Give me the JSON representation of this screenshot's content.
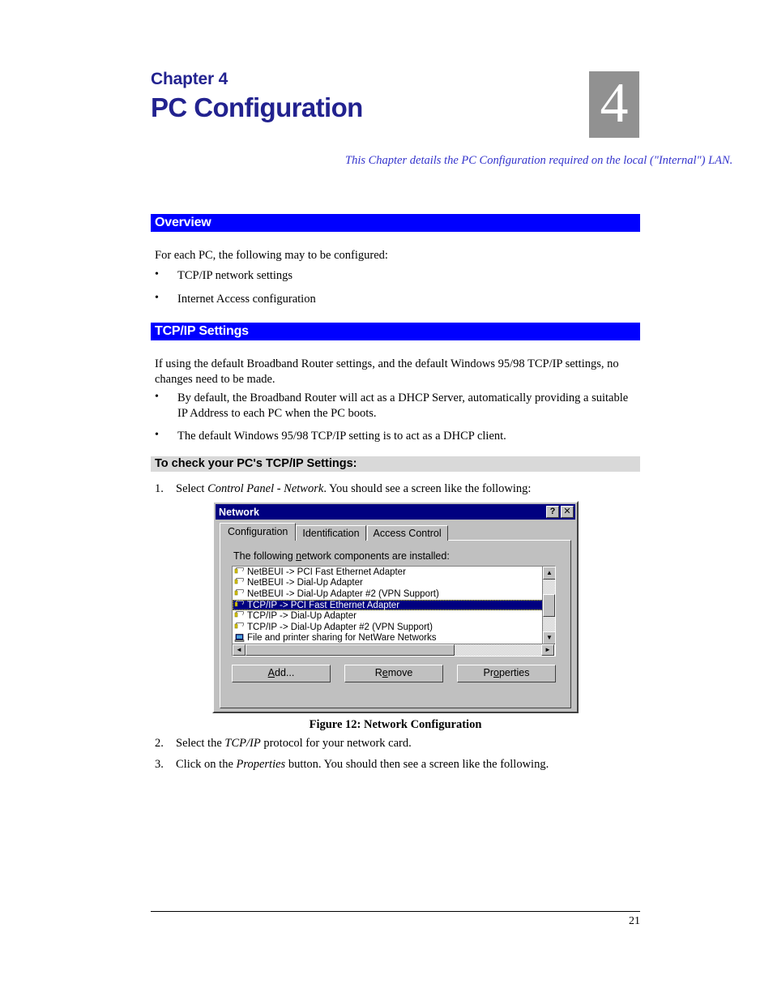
{
  "chapter": {
    "label": "Chapter 4",
    "title": "PC Configuration",
    "number": "4",
    "intro": "This Chapter details the PC Configuration required on the local (\"Internal\") LAN."
  },
  "sections": {
    "overview": {
      "heading": "Overview",
      "intro": "For each PC, the following may to be configured:",
      "bullets": [
        "TCP/IP network settings",
        "Internet Access configuration"
      ]
    },
    "tcpip": {
      "heading": "TCP/IP Settings",
      "intro": "If using the default Broadband Router settings, and the default Windows 95/98 TCP/IP settings, no changes need to be made.",
      "bullets": [
        "By default, the Broadband Router will act as a DHCP Server, automatically providing a suitable IP Address to each PC when the PC boots.",
        "The default Windows 95/98 TCP/IP setting is to act as a DHCP client."
      ]
    },
    "check_settings": {
      "heading": "To check your PC's TCP/IP Settings:",
      "step1_num": "1.",
      "step1_pre": "Select ",
      "step1_italic": "Control Panel - Network",
      "step1_post": ". You should see a screen like the following:",
      "step2_num": "2.",
      "step2_pre": "Select the ",
      "step2_italic": "TCP/IP",
      "step2_post": " protocol for your network card.",
      "step3_num": "3.",
      "step3_pre": "Click on the ",
      "step3_italic": "Properties",
      "step3_post": " button. You should then see a screen like the following."
    }
  },
  "figure": {
    "caption": "Figure 12: Network Configuration"
  },
  "dialog": {
    "title": "Network",
    "titlebar_help": "?",
    "titlebar_close": "✕",
    "tabs": [
      {
        "label": "Configuration",
        "active": true
      },
      {
        "label": "Identification",
        "active": false
      },
      {
        "label": "Access Control",
        "active": false
      }
    ],
    "list_label_pre": "The following ",
    "list_label_accel": "n",
    "list_label_post": "etwork components are installed:",
    "components": [
      {
        "label": "NetBEUI -> PCI Fast Ethernet Adapter",
        "icon": "protocol-icon",
        "selected": false
      },
      {
        "label": "NetBEUI -> Dial-Up Adapter",
        "icon": "protocol-icon",
        "selected": false
      },
      {
        "label": "NetBEUI -> Dial-Up Adapter #2 (VPN Support)",
        "icon": "protocol-icon",
        "selected": false
      },
      {
        "label": "TCP/IP -> PCI Fast Ethernet Adapter",
        "icon": "protocol-icon",
        "selected": true
      },
      {
        "label": "TCP/IP -> Dial-Up Adapter",
        "icon": "protocol-icon",
        "selected": false
      },
      {
        "label": "TCP/IP -> Dial-Up Adapter #2 (VPN Support)",
        "icon": "protocol-icon",
        "selected": false
      },
      {
        "label": "File and printer sharing for NetWare Networks",
        "icon": "computer-icon",
        "selected": false
      }
    ],
    "buttons": [
      {
        "pre": "",
        "accel": "A",
        "post": "dd..."
      },
      {
        "pre": "R",
        "accel": "e",
        "post": "move"
      },
      {
        "pre": "Pr",
        "accel": "o",
        "post": "perties"
      }
    ],
    "scroll_up": "▲",
    "scroll_down": "▼",
    "scroll_left": "◄",
    "scroll_right": "►"
  },
  "footer": {
    "page_number": "21"
  },
  "colors": {
    "section_bar": "#0000ff",
    "subsection_bar": "#d9d9d9",
    "chapter_blue": "#22228f",
    "intro_blue": "#3333cc",
    "chapter_box_gray": "#919191",
    "dialog_face": "#c0c0c0",
    "titlebar_navy": "#000080",
    "selection_navy": "#000080"
  }
}
